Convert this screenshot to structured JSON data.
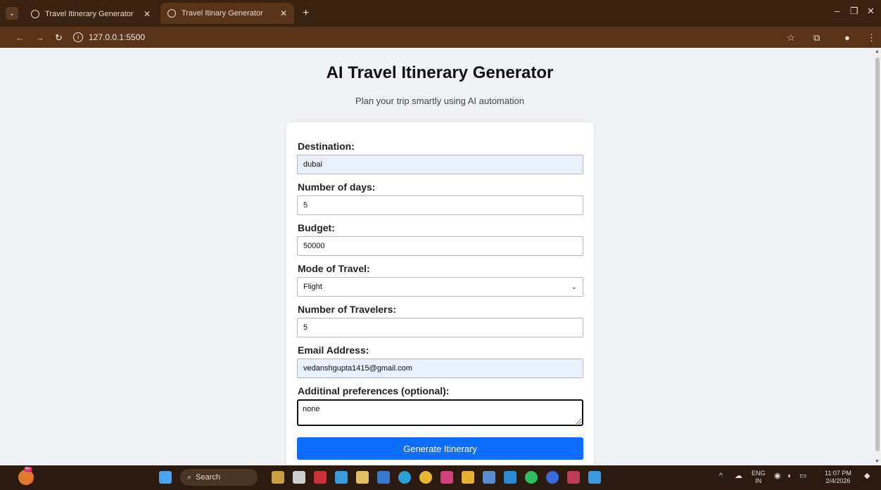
{
  "browser": {
    "tabs": [
      {
        "label": "Travel Itinerary Generator",
        "active": false
      },
      {
        "label": "Travel Itinary Generator",
        "active": true
      }
    ],
    "url": "127.0.0.1:5500"
  },
  "page": {
    "title": "AI Travel Itinerary Generator",
    "subtitle": "Plan your trip smartly using AI automation"
  },
  "form": {
    "destination": {
      "label": "Destination:",
      "value": "dubai"
    },
    "days": {
      "label": "Number of days:",
      "value": "5"
    },
    "budget": {
      "label": "Budget:",
      "value": "50000"
    },
    "mode": {
      "label": "Mode of Travel:",
      "value": "Flight"
    },
    "travelers": {
      "label": "Number of Travelers:",
      "value": "5"
    },
    "email": {
      "label": "Email Address:",
      "value": "vedanshgupta1415@gmail.com"
    },
    "preferences": {
      "label": "Additinal preferences (optional):",
      "value": "none"
    },
    "submit_label": "Generate Itinerary"
  },
  "taskbar": {
    "search_label": "Search",
    "notification_badge": "9+",
    "lang": "ENG",
    "region": "IN",
    "time": "11:07 PM",
    "date": "2/4/2026"
  },
  "colors": {
    "button": "#0d6efd",
    "autofill": "#e8f0fe",
    "browser_frame": "#3a2210"
  }
}
